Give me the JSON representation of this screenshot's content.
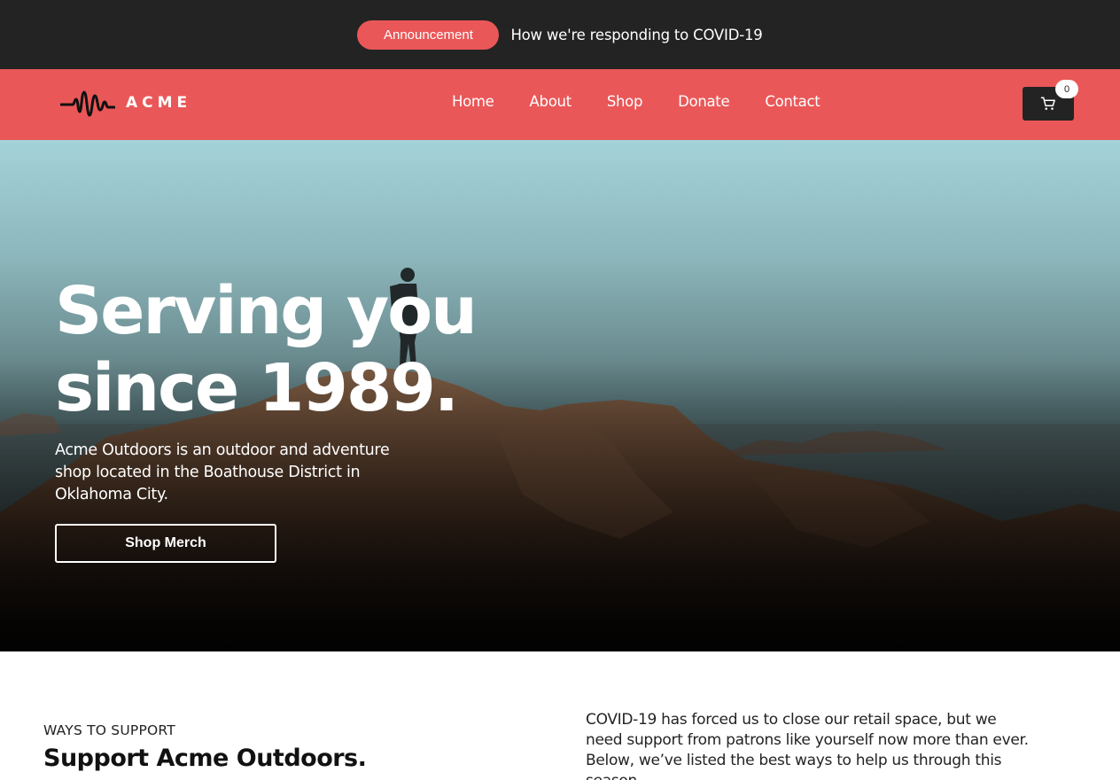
{
  "announcement": {
    "badge_label": "Announcement",
    "link_text": "How we're responding to COVID-19"
  },
  "header": {
    "logo_text": "ACME",
    "nav": [
      {
        "label": "Home"
      },
      {
        "label": "About"
      },
      {
        "label": "Shop"
      },
      {
        "label": "Donate"
      },
      {
        "label": "Contact"
      }
    ],
    "cart": {
      "icon": "cart-icon",
      "count": "0"
    }
  },
  "hero": {
    "title": "Serving you since 1989.",
    "description": "Acme Outdoors is an outdoor and adventure shop located in the Boathouse District in Oklahoma City.",
    "cta_label": "Shop Merch"
  },
  "support": {
    "eyebrow": "WAYS TO SUPPORT",
    "title": "Support Acme Outdoors.",
    "body": "COVID-19 has forced us to close our retail space, but we need support from patrons like yourself now more than ever. Below, we’ve listed the best ways to help us through this season."
  },
  "colors": {
    "accent": "#ea5758",
    "dark": "#232323",
    "white": "#ffffff"
  }
}
